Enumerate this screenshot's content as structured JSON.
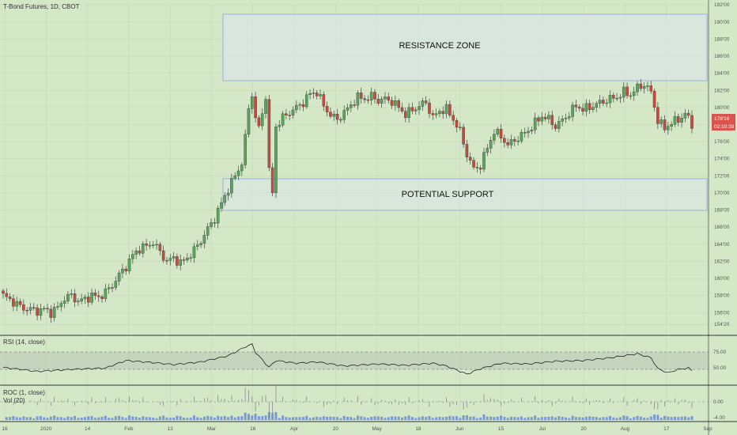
{
  "header": {
    "symbol_line": "T-Bond Futures, 1D, CBOT"
  },
  "indicators": {
    "rsi_label": "RSI (14, close)",
    "roc_label": "ROC (1, close)",
    "vol_label": "Vol (20)"
  },
  "annotations": {
    "resistance_label": "RESISTANCE ZONE",
    "support_label": "POTENTIAL SUPPORT"
  },
  "price_tag": {
    "price": "178'16",
    "countdown": "02:10:39"
  },
  "colors": {
    "up": "#5aa55a",
    "down": "#c84a3c",
    "background": "#d4e8c8",
    "price_tag": "#d9534f",
    "zone_stroke": "#9ab0e0",
    "volume": "#5b7fd6"
  },
  "chart_data": {
    "type": "candlestick",
    "title": "T-Bond Futures, 1D, CBOT",
    "xlabel": "",
    "ylabel": "",
    "x_tick_labels": [
      "16",
      "2020",
      "14",
      "Feb",
      "13",
      "Mar",
      "16",
      "Apr",
      "20",
      "May",
      "18",
      "Jun",
      "15",
      "Jul",
      "20",
      "Aug",
      "17",
      "Sep"
    ],
    "y_tick_labels": [
      "192'00",
      "190'00",
      "188'00",
      "186'00",
      "184'00",
      "182'00",
      "180'00",
      "178'00",
      "176'00",
      "174'00",
      "172'00",
      "170'00",
      "168'00",
      "166'00",
      "164'00",
      "162'00",
      "160'00",
      "158'00",
      "156'00",
      "154'20"
    ],
    "ylim": [
      153.9,
      192.2
    ],
    "series": [
      {
        "name": "T-Bond Futures",
        "anchors": [
          [
            0,
            158
          ],
          [
            2,
            157.5
          ],
          [
            4,
            157.0
          ],
          [
            6,
            156.5
          ],
          [
            8,
            156.4
          ],
          [
            10,
            156.2
          ],
          [
            12,
            156.4
          ],
          [
            14,
            156.0
          ],
          [
            16,
            156.6
          ],
          [
            18,
            157.7
          ],
          [
            20,
            158.0
          ],
          [
            22,
            157.3
          ],
          [
            24,
            157.6
          ],
          [
            26,
            158.0
          ],
          [
            28,
            157.8
          ],
          [
            30,
            158.4
          ],
          [
            32,
            159.2
          ],
          [
            34,
            160.4
          ],
          [
            36,
            161.4
          ],
          [
            38,
            162.7
          ],
          [
            40,
            163.5
          ],
          [
            42,
            163.8
          ],
          [
            44,
            164.2
          ],
          [
            46,
            163.1
          ],
          [
            48,
            162.0
          ],
          [
            50,
            162.4
          ],
          [
            52,
            161.8
          ],
          [
            54,
            162.4
          ],
          [
            56,
            163.3
          ],
          [
            58,
            164.4
          ],
          [
            60,
            165.8
          ],
          [
            62,
            167.0
          ],
          [
            64,
            168.8
          ],
          [
            66,
            170.5
          ],
          [
            68,
            172.0
          ],
          [
            70,
            173.5
          ],
          [
            71,
            176.5
          ],
          [
            72,
            179.8
          ],
          [
            73,
            181.7
          ],
          [
            74,
            178.6
          ],
          [
            75,
            177.7
          ],
          [
            76,
            179.2
          ],
          [
            77,
            181.5
          ],
          [
            78,
            172.5
          ],
          [
            79,
            170.0
          ],
          [
            80,
            177.8
          ],
          [
            82,
            178.8
          ],
          [
            84,
            179.4
          ],
          [
            86,
            180.0
          ],
          [
            88,
            180.6
          ],
          [
            90,
            181.6
          ],
          [
            92,
            181.8
          ],
          [
            94,
            180.2
          ],
          [
            96,
            179.1
          ],
          [
            98,
            178.6
          ],
          [
            100,
            179.4
          ],
          [
            102,
            180.3
          ],
          [
            104,
            181.2
          ],
          [
            106,
            181.0
          ],
          [
            108,
            181.3
          ],
          [
            110,
            180.8
          ],
          [
            112,
            181.0
          ],
          [
            114,
            180.7
          ],
          [
            116,
            180.0
          ],
          [
            118,
            179.2
          ],
          [
            120,
            179.7
          ],
          [
            122,
            180.2
          ],
          [
            124,
            180.6
          ],
          [
            126,
            178.8
          ],
          [
            128,
            179.6
          ],
          [
            130,
            179.8
          ],
          [
            132,
            178.6
          ],
          [
            134,
            177.2
          ],
          [
            136,
            174.5
          ],
          [
            138,
            172.8
          ],
          [
            140,
            173.2
          ],
          [
            142,
            175.3
          ],
          [
            144,
            177.2
          ],
          [
            146,
            176.6
          ],
          [
            148,
            175.6
          ],
          [
            150,
            176.2
          ],
          [
            152,
            176.7
          ],
          [
            154,
            177.3
          ],
          [
            156,
            178.2
          ],
          [
            158,
            179.0
          ],
          [
            160,
            178.6
          ],
          [
            162,
            177.8
          ],
          [
            164,
            178.5
          ],
          [
            166,
            179.3
          ],
          [
            168,
            180.2
          ],
          [
            170,
            179.8
          ],
          [
            172,
            180.0
          ],
          [
            174,
            180.4
          ],
          [
            176,
            180.7
          ],
          [
            178,
            181.0
          ],
          [
            180,
            181.2
          ],
          [
            182,
            181.8
          ],
          [
            184,
            181.5
          ],
          [
            186,
            182.3
          ],
          [
            188,
            182.7
          ],
          [
            190,
            181.8
          ],
          [
            191,
            180.2
          ],
          [
            192,
            178.4
          ],
          [
            194,
            177.6
          ],
          [
            196,
            178.2
          ],
          [
            198,
            178.6
          ],
          [
            200,
            179.2
          ],
          [
            201,
            178.8
          ],
          [
            202,
            177.8
          ]
        ]
      }
    ],
    "resistance_zone": [
      183.2,
      191.6
    ],
    "support_zone": [
      167.4,
      171.0
    ],
    "last_price": "178'16",
    "rsi": {
      "label": "RSI (14, close)",
      "ylim": [
        25,
        90
      ],
      "levels": [
        "75.00",
        "50.00"
      ],
      "anchors": [
        [
          0,
          50
        ],
        [
          10,
          44
        ],
        [
          20,
          47
        ],
        [
          30,
          49
        ],
        [
          36,
          60
        ],
        [
          44,
          57
        ],
        [
          50,
          54
        ],
        [
          58,
          58
        ],
        [
          66,
          67
        ],
        [
          71,
          80
        ],
        [
          73,
          84
        ],
        [
          74,
          72
        ],
        [
          78,
          50
        ],
        [
          80,
          60
        ],
        [
          86,
          56
        ],
        [
          92,
          58
        ],
        [
          100,
          52
        ],
        [
          110,
          55
        ],
        [
          118,
          53
        ],
        [
          126,
          56
        ],
        [
          130,
          52
        ],
        [
          136,
          40
        ],
        [
          140,
          48
        ],
        [
          146,
          56
        ],
        [
          154,
          55
        ],
        [
          162,
          59
        ],
        [
          170,
          60
        ],
        [
          178,
          64
        ],
        [
          186,
          70
        ],
        [
          190,
          64
        ],
        [
          192,
          48
        ],
        [
          195,
          42
        ],
        [
          198,
          47
        ],
        [
          201,
          49
        ],
        [
          202,
          45
        ]
      ]
    },
    "roc": {
      "label": "ROC (1, close)",
      "level": "0.00",
      "level2": "-4.00"
    },
    "volume": {
      "label": "Vol (20)"
    }
  }
}
